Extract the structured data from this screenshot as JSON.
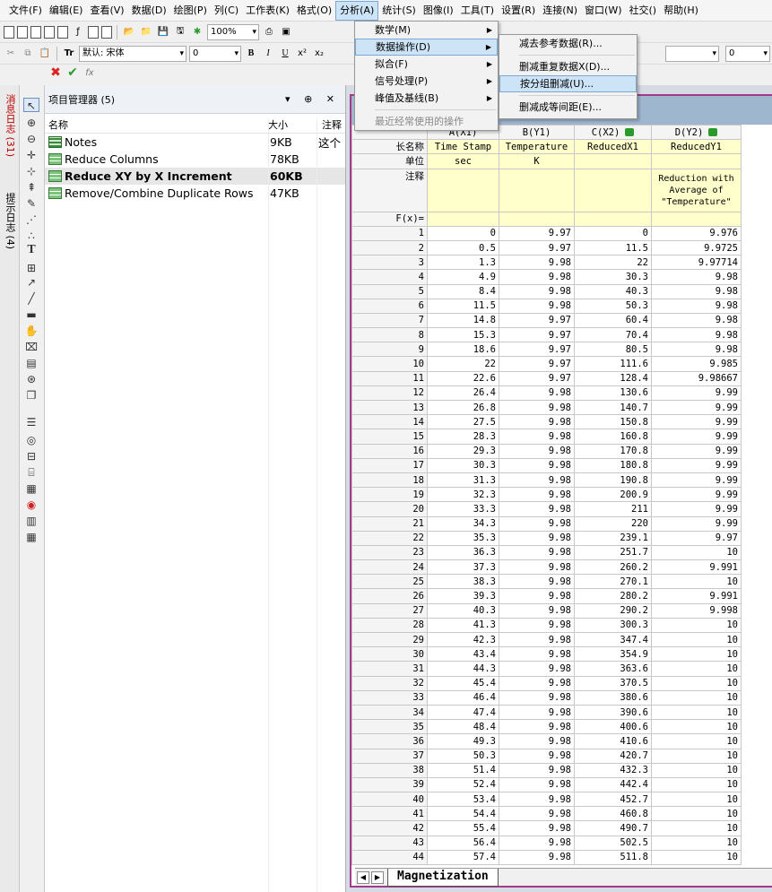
{
  "menubar": [
    "文件(F)",
    "编辑(E)",
    "查看(V)",
    "数据(D)",
    "绘图(P)",
    "列(C)",
    "工作表(K)",
    "格式(O)",
    "分析(A)",
    "统计(S)",
    "图像(I)",
    "工具(T)",
    "设置(R)",
    "连接(N)",
    "窗口(W)",
    "社交()",
    "帮助(H)"
  ],
  "toolbar": {
    "zoom": "100%",
    "font": "默认: 宋体",
    "size": "0",
    "size2": "0",
    "bold": "B",
    "italic": "I",
    "underline": "U"
  },
  "formula": {
    "fx": "fx"
  },
  "left_tabs": {
    "messages": "消息日志 (31)",
    "hints": "提示日志 (4)"
  },
  "project_manager": {
    "title": "项目管理器 (5)",
    "controls": "▾ ⊕ ✕",
    "col_name": "名称",
    "col_size": "大小",
    "col_note": "注释",
    "note_preview": "这个",
    "items": [
      {
        "name": "Notes",
        "size": "9KB"
      },
      {
        "name": "Reduce Columns",
        "size": "78KB"
      },
      {
        "name": "Reduce XY by X Increment",
        "size": "60KB"
      },
      {
        "name": "Remove/Combine Duplicate Rows",
        "size": "47KB"
      }
    ]
  },
  "analysis_menu": {
    "items": [
      "数学(M)",
      "数据操作(D)",
      "拟合(F)",
      "信号处理(P)",
      "峰值及基线(B)"
    ],
    "recent": "最近经常使用的操作"
  },
  "data_ops_menu": {
    "items": [
      "减去参考数据(R)...",
      "删减重复数据X(D)...",
      "按分组删减(U)...",
      "删减成等间距(E)..."
    ]
  },
  "sheet": {
    "columns": [
      "A(X1)",
      "B(Y1)",
      "C(X2)",
      "D(Y2)"
    ],
    "row_labels": {
      "long_name": "长名称",
      "unit": "单位",
      "comment": "注释",
      "fx": "F(x)="
    },
    "long_names": [
      "Time Stamp",
      "Temperature",
      "ReducedX1",
      "ReducedY1"
    ],
    "units": [
      "sec",
      "K",
      "",
      ""
    ],
    "comment_d": [
      "Reduction with",
      "Average of",
      "\"Temperature\""
    ],
    "rows": [
      [
        "1",
        "0",
        "9.97",
        "0",
        "9.976"
      ],
      [
        "2",
        "0.5",
        "9.97",
        "11.5",
        "9.9725"
      ],
      [
        "3",
        "1.3",
        "9.98",
        "22",
        "9.97714"
      ],
      [
        "4",
        "4.9",
        "9.98",
        "30.3",
        "9.98"
      ],
      [
        "5",
        "8.4",
        "9.98",
        "40.3",
        "9.98"
      ],
      [
        "6",
        "11.5",
        "9.98",
        "50.3",
        "9.98"
      ],
      [
        "7",
        "14.8",
        "9.97",
        "60.4",
        "9.98"
      ],
      [
        "8",
        "15.3",
        "9.97",
        "70.4",
        "9.98"
      ],
      [
        "9",
        "18.6",
        "9.97",
        "80.5",
        "9.98"
      ],
      [
        "10",
        "22",
        "9.97",
        "111.6",
        "9.985"
      ],
      [
        "11",
        "22.6",
        "9.97",
        "128.4",
        "9.98667"
      ],
      [
        "12",
        "26.4",
        "9.98",
        "130.6",
        "9.99"
      ],
      [
        "13",
        "26.8",
        "9.98",
        "140.7",
        "9.99"
      ],
      [
        "14",
        "27.5",
        "9.98",
        "150.8",
        "9.99"
      ],
      [
        "15",
        "28.3",
        "9.98",
        "160.8",
        "9.99"
      ],
      [
        "16",
        "29.3",
        "9.98",
        "170.8",
        "9.99"
      ],
      [
        "17",
        "30.3",
        "9.98",
        "180.8",
        "9.99"
      ],
      [
        "18",
        "31.3",
        "9.98",
        "190.8",
        "9.99"
      ],
      [
        "19",
        "32.3",
        "9.98",
        "200.9",
        "9.99"
      ],
      [
        "20",
        "33.3",
        "9.98",
        "211",
        "9.99"
      ],
      [
        "21",
        "34.3",
        "9.98",
        "220",
        "9.99"
      ],
      [
        "22",
        "35.3",
        "9.98",
        "239.1",
        "9.97"
      ],
      [
        "23",
        "36.3",
        "9.98",
        "251.7",
        "10"
      ],
      [
        "24",
        "37.3",
        "9.98",
        "260.2",
        "9.991"
      ],
      [
        "25",
        "38.3",
        "9.98",
        "270.1",
        "10"
      ],
      [
        "26",
        "39.3",
        "9.98",
        "280.2",
        "9.991"
      ],
      [
        "27",
        "40.3",
        "9.98",
        "290.2",
        "9.998"
      ],
      [
        "28",
        "41.3",
        "9.98",
        "300.3",
        "10"
      ],
      [
        "29",
        "42.3",
        "9.98",
        "347.4",
        "10"
      ],
      [
        "30",
        "43.4",
        "9.98",
        "354.9",
        "10"
      ],
      [
        "31",
        "44.3",
        "9.98",
        "363.6",
        "10"
      ],
      [
        "32",
        "45.4",
        "9.98",
        "370.5",
        "10"
      ],
      [
        "33",
        "46.4",
        "9.98",
        "380.6",
        "10"
      ],
      [
        "34",
        "47.4",
        "9.98",
        "390.6",
        "10"
      ],
      [
        "35",
        "48.4",
        "9.98",
        "400.6",
        "10"
      ],
      [
        "36",
        "49.3",
        "9.98",
        "410.6",
        "10"
      ],
      [
        "37",
        "50.3",
        "9.98",
        "420.7",
        "10"
      ],
      [
        "38",
        "51.4",
        "9.98",
        "432.3",
        "10"
      ],
      [
        "39",
        "52.4",
        "9.98",
        "442.4",
        "10"
      ],
      [
        "40",
        "53.4",
        "9.98",
        "452.7",
        "10"
      ],
      [
        "41",
        "54.4",
        "9.98",
        "460.8",
        "10"
      ],
      [
        "42",
        "55.4",
        "9.98",
        "490.7",
        "10"
      ],
      [
        "43",
        "56.4",
        "9.98",
        "502.5",
        "10"
      ],
      [
        "44",
        "57.4",
        "9.98",
        "511.8",
        "10"
      ]
    ],
    "tab": "Magnetization"
  },
  "colors": {
    "menu_highlight": "#cde4f7",
    "comment_fill": "#ffffcc",
    "frame": "#a33a8a",
    "title_bar": "#9fb6cf"
  }
}
